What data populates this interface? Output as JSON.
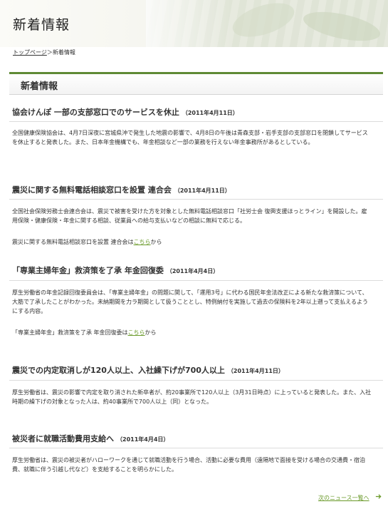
{
  "header": {
    "title": "新着情報"
  },
  "breadcrumb": {
    "top": "トップページ",
    "separator": "＞",
    "current": "新着情報"
  },
  "section": {
    "title": "新着情報"
  },
  "articles": [
    {
      "title": "協会けんぽ 一部の支部窓口でのサービスを休止",
      "date": "（2011年4月11日）",
      "body": "全国健康保険協会は、4月7日深夜に宮城県沖で発生した地震の影響で、4月8日の午後は青森支部・岩手支部の支部窓口を閉鎖してサービスを休止すると発表した。また、日本年金機構でも、年金相談など一部の業務を行えない年金事務所があるとしている。"
    },
    {
      "title": "震災に関する無料電話相談窓口を設置 連合会",
      "date": "（2011年4月11日）",
      "body": "全国社会保険労務士会連合会は、震災で被害を受けた方を対象とした無料電話相談窓口「社労士会 復興支援ほっとライン」を開設した。雇用保険・健康保険・年金に関する相談、従業員への給与支払いなどの相談に無料で応じる。",
      "ref_prefix": "震災に関する無料電話相談窓口を設置 連合会は",
      "ref_link": "こちら",
      "ref_suffix": "から"
    },
    {
      "title": "「専業主婦年金」救済策を了承 年金回復委",
      "date": "（2011年4月4日）",
      "body": "厚生労働省の年金記録回復委員会は、「専業主婦年金」の問題に関して、「運用3号」に代わる国民年金法改正による新たな救済策について、大筋で了承したことがわかった。未納期間を力ラ期間として扱うこととし、特例納付を実施して過去の保険料を2年以上遡って支払えるようにする内容。",
      "ref_prefix": "「専業主婦年金」救済策を了承 年金回復委は",
      "ref_link": "こちら",
      "ref_suffix": "から"
    },
    {
      "title": "震災での内定取消しが120人以上、入社繰下げが700人以上",
      "date": "（2011年4月11日）",
      "body": "厚生労働省は、震災の影響で内定を取り消された新卒者が、約20事業所で120人以上（3月31日時点）に上っていると発表した。また、入社時期の繰下げの対象となった人は、約40事業所で700人以上（同）となった。"
    },
    {
      "title": "被災者に就職活動費用支給へ",
      "date": "（2011年4月4日）",
      "body": "厚生労働省は、震災の被災者がハローワークを通じて就職活動を行う場合、活動に必要な費用（遠隔地で面接を受ける場合の交通費・宿泊費、就職に伴う引越し代など）を支給することを明らかにした。"
    }
  ],
  "footer": {
    "next_label": "次のニュース一覧へ"
  }
}
